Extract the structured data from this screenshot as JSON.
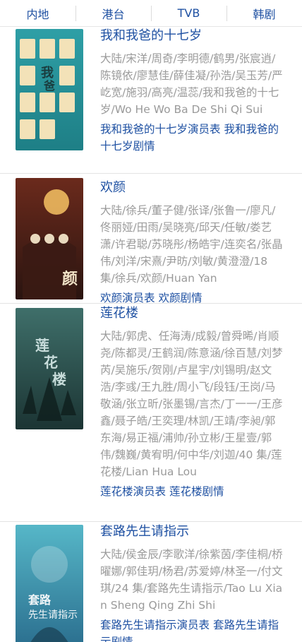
{
  "tabs": [
    "内地",
    "港台",
    "TVB",
    "韩剧"
  ],
  "items": [
    {
      "title": "我和我爸的十七岁",
      "desc": "大陆/宋洋/周奇/李明德/鹤男/张宸逍/陈镜依/廖慧佳/薛佳凝/孙浩/吴玉芳/严屹宽/施羽/高亮/温蕊/我和我爸的十七岁/Wo He Wo Ba De Shi Qi Sui",
      "link_cast": "我和我爸的十七岁演员表",
      "link_plot": "我和我爸的十七岁剧情",
      "poster_icon": "poster-image",
      "poster_text": "我和我爸的十七岁",
      "colors": {
        "bg1": "#2e9fa6",
        "bg2": "#1e7f86",
        "accent": "#f3e2b8"
      }
    },
    {
      "title": "欢颜",
      "desc": "大陆/徐兵/董子健/张译/张鲁一/廖凡/佟丽娅/田雨/吴晓亮/邱天/任敏/娄艺潇/许君聪/苏晓彤/杨皓宇/连奕名/张晶伟/刘洋/宋熹/尹昉/刘敏/黄澄澄/18 集/徐兵/欢颜/Huan Yan",
      "link_cast": "欢颜演员表",
      "link_plot": "欢颜剧情",
      "poster_icon": "poster-image",
      "poster_text": "欢颜",
      "colors": {
        "bg1": "#6b2a1c",
        "bg2": "#2a1410",
        "accent": "#e7b25c"
      }
    },
    {
      "title": "莲花楼",
      "desc": "大陆/郭虎、任海涛/成毅/曾舜晞/肖顺尧/陈都灵/王鹤润/陈意涵/徐百慧/刘梦芮/吴施乐/贺刚/卢星宇/刘锡明/赵文浩/李彧/王九胜/周小飞/段钰/王岗/马敬涵/张立昕/张墨锡/言杰/丁一一/王彦鑫/聂子皓/王奕理/林凯/王靖/李昶/郭东海/易正福/浦帅/孙立彬/王星壹/郭伟/魏巍/黄宥明/何中华/刘迦/40 集/莲花楼/Lian Hua Lou",
      "link_cast": "莲花楼演员表",
      "link_plot": "莲花楼剧情",
      "poster_icon": "poster-image",
      "poster_text": "莲花楼",
      "colors": {
        "bg1": "#3f6f6a",
        "bg2": "#1b3433",
        "accent": "#d9ecea"
      }
    },
    {
      "title": "套路先生请指示",
      "desc": "大陆/侯金辰/李歌洋/徐紫茵/李佳桐/桥曜娜/郭佳玥/杨君/苏爱婷/林圣一/付文琪/24 集/套路先生请指示/Tao Lu Xian Sheng Qing Zhi Shi",
      "link_cast": "套路先生请指示演员表",
      "link_plot": "套路先生请指示剧情",
      "poster_icon": "poster-image",
      "poster_text": "套路先生请指示",
      "colors": {
        "bg1": "#56b7c8",
        "bg2": "#2b6f8f",
        "accent": "#f1f6f8"
      }
    }
  ]
}
